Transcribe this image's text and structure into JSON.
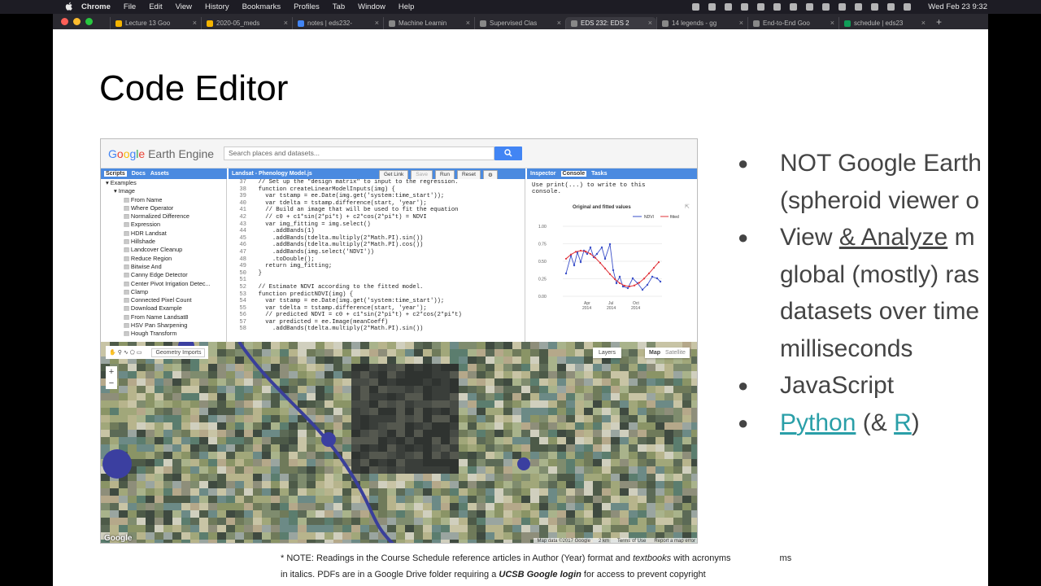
{
  "menubar": {
    "app": "Chrome",
    "items": [
      "File",
      "Edit",
      "View",
      "History",
      "Bookmarks",
      "Profiles",
      "Tab",
      "Window",
      "Help"
    ],
    "clock": "Wed Feb 23  9:32"
  },
  "tabs": [
    {
      "label": "Lecture 13  Goo",
      "color": "#f4b400"
    },
    {
      "label": "2020-05_meds",
      "color": "#f4b400"
    },
    {
      "label": "notes | eds232-",
      "color": "#4285f4"
    },
    {
      "label": "Machine Learnin",
      "color": "#888888"
    },
    {
      "label": "Supervised Clas",
      "color": "#888888"
    },
    {
      "label": "EDS 232: EDS 2",
      "color": "#888888",
      "active": true
    },
    {
      "label": "14 legends - gg",
      "color": "#888888"
    },
    {
      "label": "End-to-End Goo",
      "color": "#888888"
    },
    {
      "label": "schedule | eds23",
      "color": "#0f9d58"
    }
  ],
  "slide": {
    "title": "Code Editor",
    "bullets": {
      "b1": "NOT Google Earth",
      "b1b": "(spheroid viewer o",
      "b2a": "View ",
      "b2link": "& Analyze",
      "b2b": " m",
      "b2c": "global (mostly) ras",
      "b2d": "datasets over time",
      "b2e": "milliseconds",
      "b3": "JavaScript",
      "b4link": "Python",
      "b4mid": " (& ",
      "b4r": "R",
      "b4end": ")"
    },
    "footnote": {
      "line1a": "* NOTE: Readings in the Course Schedule reference articles in Author (Year) format and ",
      "line1italic": "textbooks",
      "line1b": " with acronyms",
      "line1tail": "ms",
      "line2a": "in italics. PDFs are in a Google Drive folder requiring a ",
      "line2bold": "UCSB Google login",
      "line2b": " for access to prevent copyright"
    }
  },
  "gee": {
    "logo": "Google Earth Engine",
    "search_placeholder": "Search places and datasets...",
    "left_tabs": [
      "Scripts",
      "Docs",
      "Assets"
    ],
    "tree_root": "Examples",
    "tree_folder": "Image",
    "tree_items": [
      "From Name",
      "Where Operator",
      "Normalized Difference",
      "Expression",
      "HDR Landsat",
      "Hillshade",
      "Landcover Cleanup",
      "Reduce Region",
      "Bitwise And",
      "Canny Edge Detector",
      "Center Pivot Irrigation Detec...",
      "Clamp",
      "Connected Pixel Count",
      "Download Example",
      "From Name Landsat8",
      "HSV Pan Sharpening",
      "Hough Transform"
    ],
    "editor_title": "Landsat - Phenology Model.js",
    "editor_buttons": [
      "Get Link",
      "Save",
      "Run",
      "Reset"
    ],
    "code_lines": [
      {
        "n": "37",
        "t": "  // Set up the \"design matrix\" to input to the regression."
      },
      {
        "n": "38",
        "t": "  function createLinearModelInputs(img) {"
      },
      {
        "n": "39",
        "t": "    var tstamp = ee.Date(img.get('system:time_start'));"
      },
      {
        "n": "40",
        "t": "    var tdelta = tstamp.difference(start, 'year');"
      },
      {
        "n": "41",
        "t": "    // Build an image that will be used to fit the equation"
      },
      {
        "n": "42",
        "t": "    // c0 + c1*sin(2*pi*t) + c2*cos(2*pi*t) = NDVI"
      },
      {
        "n": "43",
        "t": "    var img_fitting = img.select()"
      },
      {
        "n": "44",
        "t": "      .addBands(1)"
      },
      {
        "n": "45",
        "t": "      .addBands(tdelta.multiply(2*Math.PI).sin())"
      },
      {
        "n": "46",
        "t": "      .addBands(tdelta.multiply(2*Math.PI).cos())"
      },
      {
        "n": "47",
        "t": "      .addBands(img.select('NDVI'))"
      },
      {
        "n": "48",
        "t": "      .toDouble();"
      },
      {
        "n": "49",
        "t": "    return img_fitting;"
      },
      {
        "n": "50",
        "t": "  }"
      },
      {
        "n": "51",
        "t": ""
      },
      {
        "n": "52",
        "t": "  // Estimate NDVI according to the fitted model."
      },
      {
        "n": "53",
        "t": "  function predictNDVI(img) {"
      },
      {
        "n": "54",
        "t": "    var tstamp = ee.Date(img.get('system:time_start'));"
      },
      {
        "n": "55",
        "t": "    var tdelta = tstamp.difference(start, 'year');"
      },
      {
        "n": "56",
        "t": "    // predicted NDVI = c0 + c1*sin(2*pi*t) + c2*cos(2*pi*t)"
      },
      {
        "n": "57",
        "t": "    var predicted = ee.Image(meanCoeff)"
      },
      {
        "n": "58",
        "t": "      .addBands(tdelta.multiply(2*Math.PI).sin())"
      }
    ],
    "right_tabs": [
      "Inspector",
      "Console",
      "Tasks"
    ],
    "console_text_1": "Use print(...) to write to this",
    "console_text_2": "console.",
    "chart_title": "Original and fitted values",
    "chart_legend": [
      "NDVI",
      "fitted"
    ],
    "chart_yticks": [
      "1.00",
      "0.75",
      "0.50",
      "0.25",
      "0.00"
    ],
    "chart_xticks": [
      "Apr\n2014",
      "Jul\n2014",
      "Oct\n2014"
    ],
    "map_tool_label": "Geometry Imports",
    "layers_label": "Layers",
    "map_label": "Map",
    "satellite_label": "Satellite",
    "google_watermark": "Google",
    "map_footer": [
      "Map data ©2017 Google",
      "2 km",
      "Terms of Use",
      "Report a map error"
    ]
  },
  "colors": {
    "accent_link": "#2a9fa8",
    "gee_blue": "#4a8ae0",
    "ndvi_series": "#3a4fc9",
    "fitted_series": "#e0333a"
  }
}
